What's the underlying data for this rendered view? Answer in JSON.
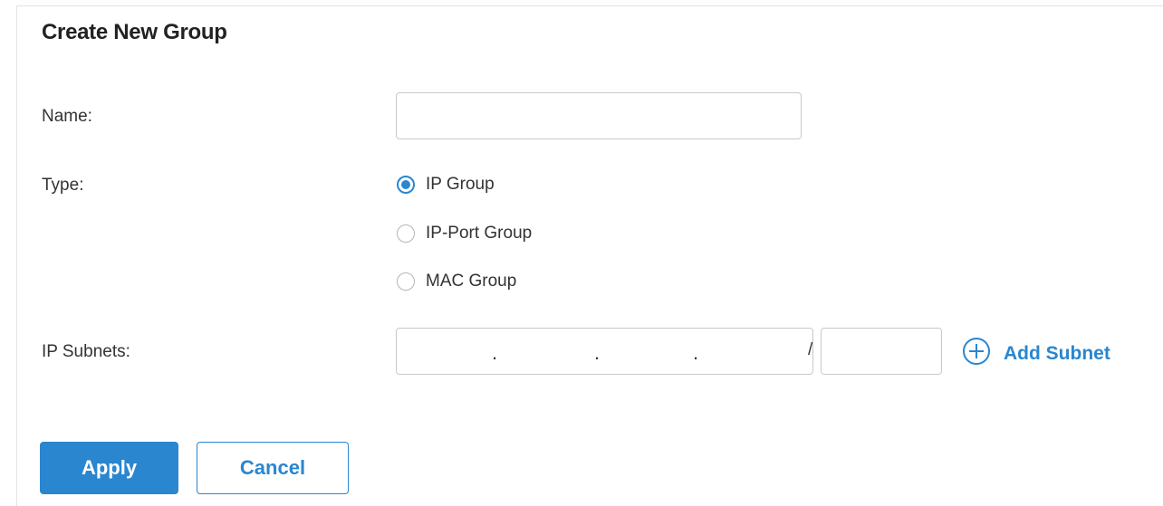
{
  "form": {
    "title": "Create New Group",
    "name": {
      "label": "Name:",
      "value": ""
    },
    "type": {
      "label": "Type:",
      "options": [
        {
          "label": "IP Group",
          "checked": true
        },
        {
          "label": "IP-Port Group",
          "checked": false
        },
        {
          "label": "MAC Group",
          "checked": false
        }
      ]
    },
    "ip_subnets": {
      "label": "IP Subnets:",
      "separator": ".",
      "slash": "/",
      "add_label": "Add Subnet",
      "add_icon": "plus-circle-icon"
    },
    "buttons": {
      "apply": "Apply",
      "cancel": "Cancel"
    }
  },
  "colors": {
    "accent": "#2a86cf",
    "text": "#333333",
    "border": "#c9c9c9"
  }
}
